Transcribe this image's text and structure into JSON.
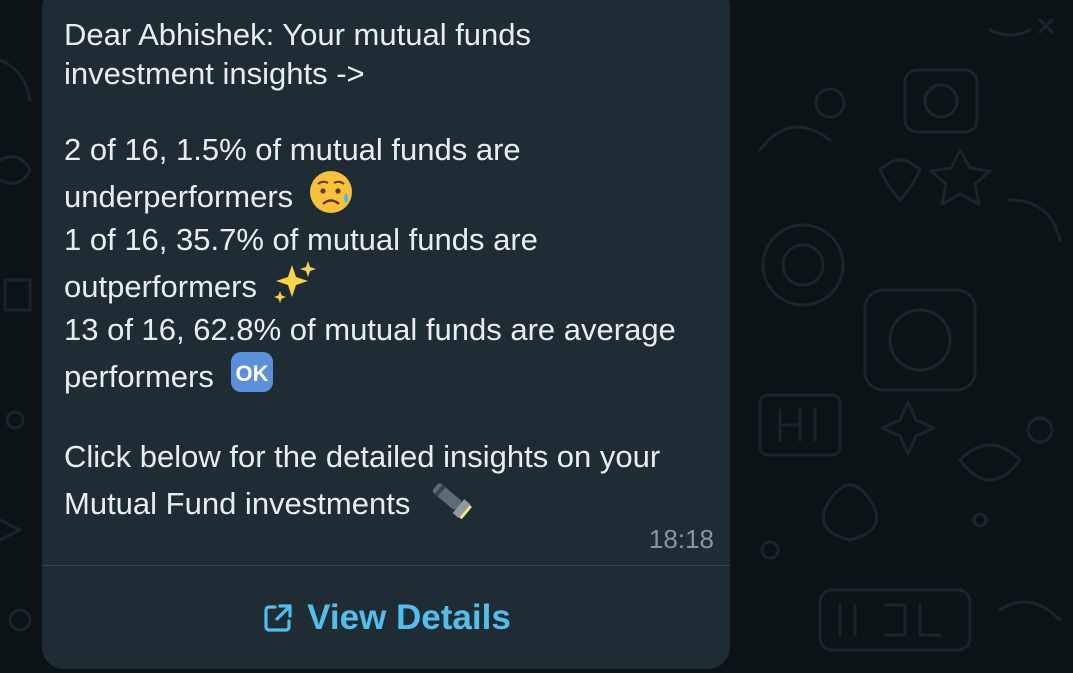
{
  "message": {
    "greeting_line1": "Dear Abhishek: Your mutual funds",
    "greeting_line2": "investment insights ->",
    "stat1_line1": "2 of 16, 1.5% of mutual funds are",
    "stat1_line2": "underperformers",
    "stat1_emoji": "sad-sweat-emoji",
    "stat2_line1": "1 of 16, 35.7% of mutual funds are",
    "stat2_line2": "outperformers",
    "stat2_emoji": "sparkles-emoji",
    "stat3_line1": "13 of 16, 62.8% of mutual funds are average",
    "stat3_line2": "performers",
    "stat3_emoji": "ok-button-emoji",
    "cta_line1": "Click below for the detailed insights on your",
    "cta_line2": "Mutual Fund investments",
    "cta_emoji": "flashlight-emoji",
    "timestamp": "18:18"
  },
  "action": {
    "label": "View Details",
    "icon": "external-link-icon",
    "color": "#53bdeb"
  },
  "colors": {
    "bubble": "#202c33",
    "background": "#0c1317",
    "text": "#e9edef",
    "meta": "#8696a0"
  }
}
